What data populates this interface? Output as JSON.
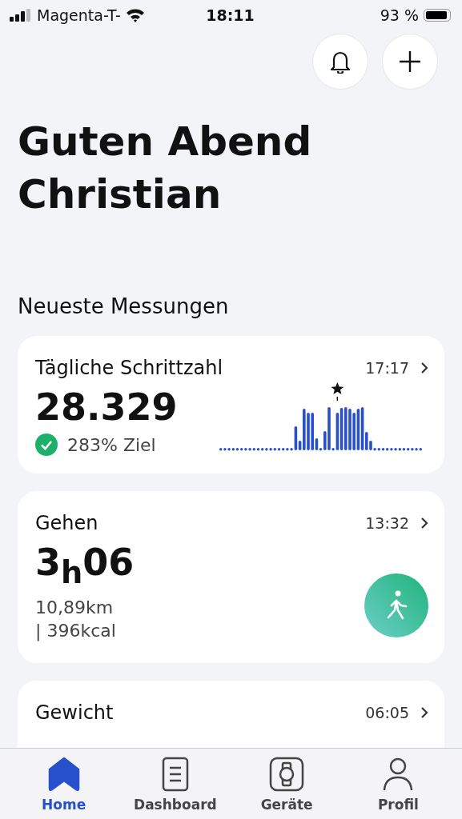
{
  "status_bar": {
    "carrier": "Magenta-T-",
    "time": "18:11",
    "battery": "93 %"
  },
  "greeting": [
    "Guten Abend",
    "Christian"
  ],
  "section_title": "Neueste Messungen",
  "cards": [
    {
      "kind": "steps",
      "title": "Tägliche Schrittzahl",
      "time": "17:17",
      "value": "28.329",
      "goal": "283% Ziel",
      "goal_reached": true
    },
    {
      "kind": "walk",
      "title": "Gehen",
      "time": "13:32",
      "value": "3$_{h}$06",
      "details": [
        "10,89km",
        "| 396kcal"
      ]
    },
    {
      "kind": "plain",
      "title": "Gewicht",
      "time": "06:05"
    }
  ],
  "tabs": [
    {
      "label": "Home",
      "selected": true
    },
    {
      "label": "Dashboard",
      "selected": false
    },
    {
      "label": "Geräte",
      "selected": false
    },
    {
      "label": "Profil",
      "selected": false
    }
  ]
}
